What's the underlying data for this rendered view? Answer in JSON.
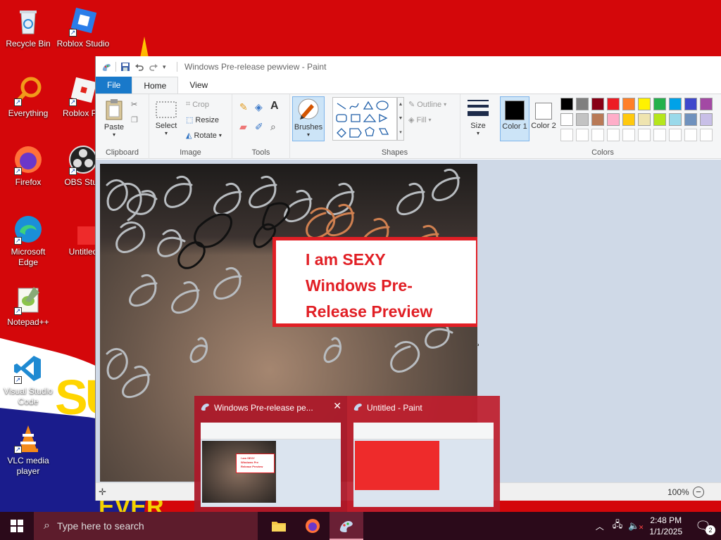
{
  "desktop": {
    "icons": [
      {
        "label": "Recycle Bin"
      },
      {
        "label": "Roblox Studio"
      },
      {
        "label": "Everything"
      },
      {
        "label": "Roblox Pla"
      },
      {
        "label": "Firefox"
      },
      {
        "label": "OBS Stud"
      },
      {
        "label": "Microsoft Edge"
      },
      {
        "label": "Untitled"
      },
      {
        "label": "Notepad++"
      },
      {
        "label": "Visual Studio Code"
      },
      {
        "label": "VLC media player"
      }
    ],
    "wallpaper_text": "SU",
    "wallpaper_bar_text": "EVER"
  },
  "paint": {
    "title": "Windows Pre-release pewview - Paint",
    "tabs": [
      "File",
      "Home",
      "View"
    ],
    "ribbon": {
      "paste": "Paste",
      "clipboard": "Clipboard",
      "select": "Select",
      "crop": "Crop",
      "resize": "Resize",
      "rotate": "Rotate",
      "image": "Image",
      "tools": "Tools",
      "brushes": "Brushes",
      "outline": "Outline",
      "fill": "Fill",
      "shapes": "Shapes",
      "size": "Size",
      "color1": "Color 1",
      "color2": "Color 2",
      "colors": "Colors"
    },
    "palette_row1": [
      "#000000",
      "#7f7f7f",
      "#880015",
      "#ed1c24",
      "#ff7f27",
      "#fff200",
      "#22b14c",
      "#00a2e8",
      "#3f48cc",
      "#a349a4"
    ],
    "palette_row2": [
      "#ffffff",
      "#c3c3c3",
      "#b97a57",
      "#ffaec9",
      "#ffc90e",
      "#efe4b0",
      "#b5e61d",
      "#99d9ea",
      "#7092be",
      "#c8bfe7"
    ],
    "canvas_text": [
      "I am SEXY",
      "Windows Pre-",
      "Release Preview"
    ],
    "zoom": "100%"
  },
  "thumbnails": [
    {
      "title": "Windows Pre-release pe..."
    },
    {
      "title": "Untitled - Paint"
    }
  ],
  "thumb_preview_text": [
    "I am SEXY",
    "Windows Pre",
    "Release Preview"
  ],
  "taskbar": {
    "search_placeholder": "Type here to search",
    "time": "2:48 PM",
    "date": "1/1/2025",
    "notification_count": "2"
  }
}
